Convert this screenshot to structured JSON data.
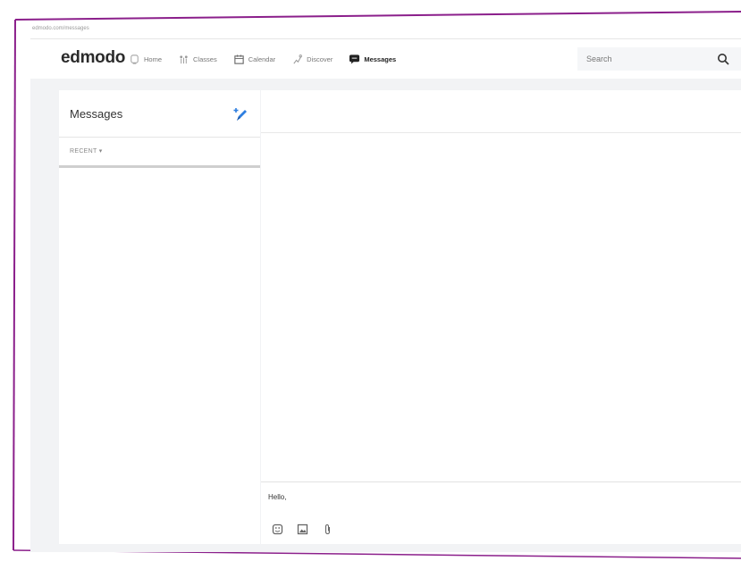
{
  "browser": {
    "url_text": "edmodo.com/messages"
  },
  "header": {
    "logo": "edmodo",
    "nav": [
      {
        "label": "Home",
        "icon": "home-icon"
      },
      {
        "label": "Classes",
        "icon": "classes-icon"
      },
      {
        "label": "Calendar",
        "icon": "calendar-icon"
      },
      {
        "label": "Discover",
        "icon": "discover-icon"
      },
      {
        "label": "Messages",
        "icon": "messages-icon",
        "active": true
      }
    ],
    "search_placeholder": "Search"
  },
  "messages_panel": {
    "title": "Messages",
    "filter_label": "RECENT ▾"
  },
  "compose": {
    "text": "Hello,",
    "tools": [
      "emoji-icon",
      "image-icon",
      "attachment-icon"
    ]
  },
  "colors": {
    "accent": "#2f7fe0",
    "frame": "#8b1f8b",
    "page_bg": "#f2f3f5"
  }
}
